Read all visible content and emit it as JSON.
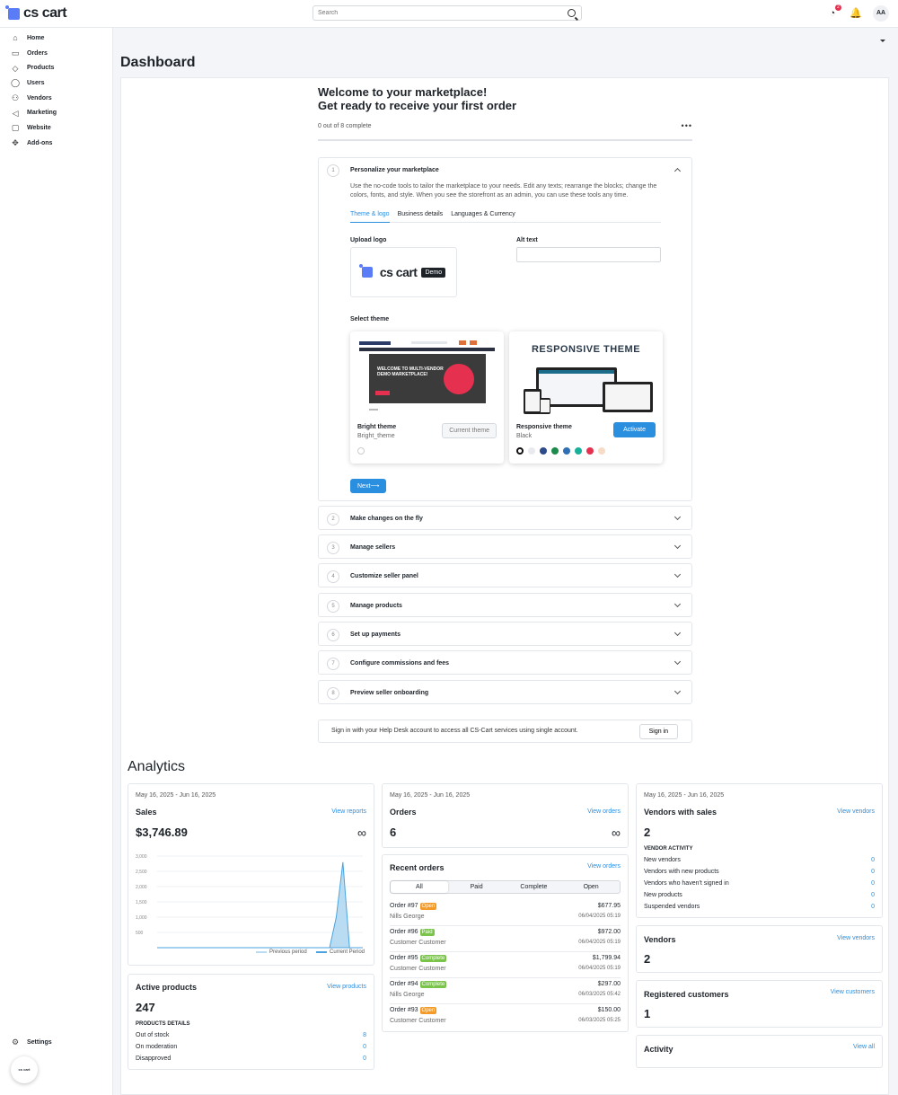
{
  "app": {
    "logo_text": "cs cart"
  },
  "search": {
    "placeholder": "Search"
  },
  "header": {
    "notification_count": "2",
    "avatar_initials": "AA"
  },
  "sidebar": {
    "items": [
      {
        "label": "Home",
        "icon": "home-icon"
      },
      {
        "label": "Orders",
        "icon": "orders-icon"
      },
      {
        "label": "Products",
        "icon": "tag-icon"
      },
      {
        "label": "Users",
        "icon": "user-icon"
      },
      {
        "label": "Vendors",
        "icon": "vendors-icon"
      },
      {
        "label": "Marketing",
        "icon": "megaphone-icon"
      },
      {
        "label": "Website",
        "icon": "monitor-icon"
      },
      {
        "label": "Add-ons",
        "icon": "puzzle-icon"
      }
    ],
    "settings_label": "Settings",
    "mini_logo_text": "cs cart"
  },
  "page": {
    "title": "Dashboard"
  },
  "onboarding": {
    "title_line1": "Welcome to your marketplace!",
    "title_line2": "Get ready to receive your first order",
    "progress_text": "0 out of 8 complete",
    "more": "•••",
    "step1": {
      "num": "1",
      "title": "Personalize your marketplace",
      "desc": "Use the no-code tools to tailor the marketplace to your needs. Edit any texts; rearrange the blocks; change the colors, fonts, and style. When you see the storefront as an admin, you can use these tools any time.",
      "tabs": [
        "Theme & logo",
        "Business details",
        "Languages & Currency"
      ],
      "upload_logo_label": "Upload logo",
      "logo_text": "cs cart",
      "demo_chip": "Demo",
      "alt_text_label": "Alt text",
      "select_theme_label": "Select theme",
      "themes": [
        {
          "name": "Bright theme",
          "sub": "Bright_theme",
          "button": "Current theme",
          "banner": "WELCOME TO MULTI-VENDOR DEMO MARKETPLACE!"
        },
        {
          "name": "Responsive theme",
          "sub": "Black",
          "button": "Activate",
          "banner": "RESPONSIVE THEME"
        }
      ],
      "swatches": [
        "#ffffff",
        "#e8eaee",
        "#2d4a8a",
        "#1b8a4c",
        "#2f6fb5",
        "#17b09a",
        "#e5304f",
        "#f6dcc6"
      ],
      "next_label": "Next⟶"
    },
    "steps": [
      {
        "num": "2",
        "title": "Make changes on the fly"
      },
      {
        "num": "3",
        "title": "Manage sellers"
      },
      {
        "num": "4",
        "title": "Customize seller panel"
      },
      {
        "num": "5",
        "title": "Manage products"
      },
      {
        "num": "6",
        "title": "Set up payments"
      },
      {
        "num": "7",
        "title": "Configure commissions and fees"
      },
      {
        "num": "8",
        "title": "Preview seller onboarding"
      }
    ],
    "signin_text": "Sign in with your Help Desk account to access all CS-Cart services using single account.",
    "signin_button": "Sign in"
  },
  "analytics": {
    "title": "Analytics",
    "date_range": "May 16, 2025 - Jun 16, 2025",
    "sales": {
      "title": "Sales",
      "link": "View reports",
      "value": "$3,746.89",
      "infinity": "∞"
    },
    "orders": {
      "title": "Orders",
      "link": "View orders",
      "value": "6",
      "infinity": "∞"
    },
    "vendors_with_sales": {
      "title": "Vendors with sales",
      "link": "View vendors",
      "value": "2",
      "activity_heading": "VENDOR ACTIVITY",
      "rows": [
        {
          "label": "New vendors",
          "value": "0"
        },
        {
          "label": "Vendors with new products",
          "value": "0"
        },
        {
          "label": "Vendors who haven't signed in",
          "value": "0"
        },
        {
          "label": "New products",
          "value": "0"
        },
        {
          "label": "Suspended vendors",
          "value": "0"
        }
      ]
    },
    "vendors": {
      "title": "Vendors",
      "link": "View vendors",
      "value": "2"
    },
    "customers": {
      "title": "Registered customers",
      "link": "View customers",
      "value": "1"
    },
    "activity": {
      "title": "Activity",
      "link": "View all"
    },
    "active_products": {
      "title": "Active products",
      "link": "View products",
      "value": "247",
      "details_heading": "PRODUCTS DETAILS",
      "rows": [
        {
          "label": "Out of stock",
          "value": "8"
        },
        {
          "label": "On moderation",
          "value": "0"
        },
        {
          "label": "Disapproved",
          "value": "0"
        }
      ]
    },
    "recent_orders": {
      "title": "Recent orders",
      "link": "View orders",
      "filters": [
        "All",
        "Paid",
        "Complete",
        "Open"
      ],
      "rows": [
        {
          "order": "Order #97",
          "status": "Open",
          "customer": "Nills George",
          "amount": "$677.95",
          "date": "06/04/2025 05:19"
        },
        {
          "order": "Order #96",
          "status": "Paid",
          "customer": "Customer Customer",
          "amount": "$972.00",
          "date": "06/04/2025 05:19"
        },
        {
          "order": "Order #95",
          "status": "Complete",
          "customer": "Customer Customer",
          "amount": "$1,799.94",
          "date": "06/04/2025 05:19"
        },
        {
          "order": "Order #94",
          "status": "Complete",
          "customer": "Nills George",
          "amount": "$297.00",
          "date": "06/03/2025 05:42"
        },
        {
          "order": "Order #93",
          "status": "Open",
          "customer": "Customer Customer",
          "amount": "$150.00",
          "date": "06/03/2025 05:25"
        }
      ]
    }
  },
  "chart_data": {
    "type": "area",
    "y_ticks": [
      "3,000",
      "2,500",
      "2,000",
      "1,500",
      "1,000",
      "500"
    ],
    "ylim": [
      0,
      3000
    ],
    "x_count": 32,
    "series": [
      {
        "name": "Previous period",
        "values": []
      },
      {
        "name": "Current Period",
        "values": [
          0,
          0,
          0,
          0,
          0,
          0,
          0,
          0,
          0,
          0,
          0,
          0,
          0,
          0,
          0,
          0,
          0,
          0,
          0,
          0,
          0,
          0,
          0,
          0,
          0,
          0,
          0,
          1000,
          2800,
          0,
          0,
          0
        ]
      }
    ],
    "colors": {
      "current": "#4aa3df",
      "previous": "#b9dcf3"
    }
  }
}
